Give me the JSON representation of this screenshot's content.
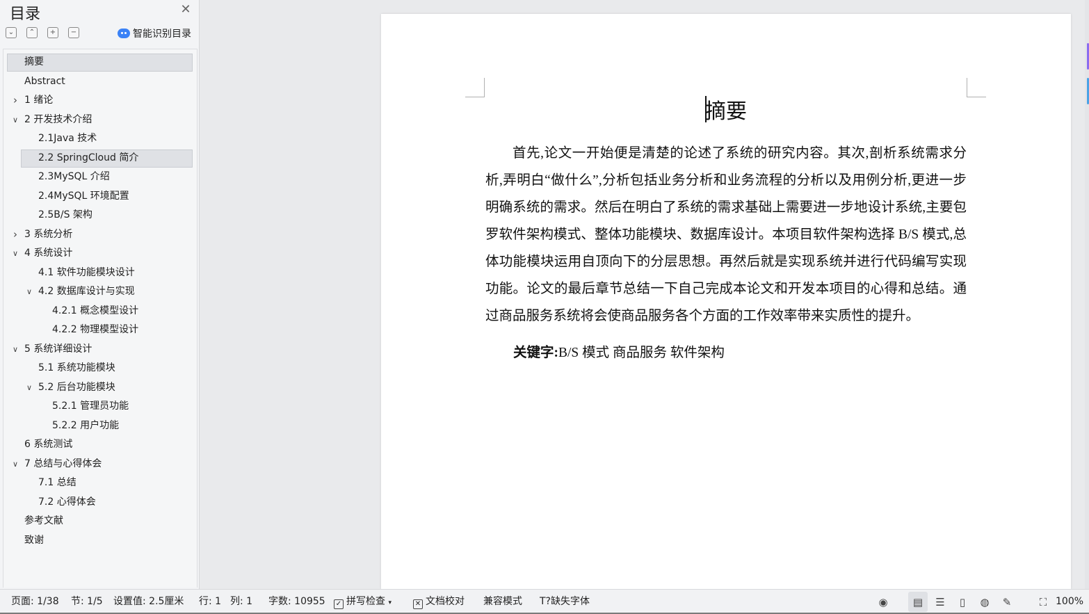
{
  "toc": {
    "title": "目录",
    "close_icon": "close-icon",
    "tools": [
      "collapse-all-icon",
      "expand-all-icon",
      "add-level-icon",
      "remove-level-icon"
    ],
    "smart_label": "智能识别目录",
    "items": [
      {
        "label": "摘要",
        "level": 1,
        "expander": "none",
        "selected": true
      },
      {
        "label": "Abstract",
        "level": 1,
        "expander": "none"
      },
      {
        "label": "1 绪论",
        "level": 1,
        "expander": "collapsed"
      },
      {
        "label": "2 开发技术介绍",
        "level": 1,
        "expander": "expanded"
      },
      {
        "label": "2.1Java 技术",
        "level": 2,
        "expander": "none"
      },
      {
        "label": "2.2 SpringCloud 简介",
        "level": 2,
        "expander": "none",
        "selected": true
      },
      {
        "label": "2.3MySQL  介绍",
        "level": 2,
        "expander": "none"
      },
      {
        "label": "2.4MySQL 环境配置",
        "level": 2,
        "expander": "none"
      },
      {
        "label": "2.5B/S 架构",
        "level": 2,
        "expander": "none"
      },
      {
        "label": "3 系统分析",
        "level": 1,
        "expander": "collapsed"
      },
      {
        "label": "4 系统设计",
        "level": 1,
        "expander": "expanded"
      },
      {
        "label": "4.1  软件功能模块设计",
        "level": 2,
        "expander": "none"
      },
      {
        "label": "4.2 数据库设计与实现",
        "level": 2,
        "expander": "expanded"
      },
      {
        "label": "4.2.1 概念模型设计",
        "level": 3,
        "expander": "none"
      },
      {
        "label": "4.2.2 物理模型设计",
        "level": 3,
        "expander": "none"
      },
      {
        "label": "5 系统详细设计",
        "level": 1,
        "expander": "expanded"
      },
      {
        "label": "5.1 系统功能模块",
        "level": 2,
        "expander": "none"
      },
      {
        "label": "5.2 后台功能模块",
        "level": 2,
        "expander": "expanded"
      },
      {
        "label": "5.2.1 管理员功能",
        "level": 3,
        "expander": "none"
      },
      {
        "label": "5.2.2 用户功能",
        "level": 3,
        "expander": "none"
      },
      {
        "label": "6 系统测试",
        "level": 1,
        "expander": "none"
      },
      {
        "label": "7 总结与心得体会",
        "level": 1,
        "expander": "expanded"
      },
      {
        "label": "7.1  总结",
        "level": 2,
        "expander": "none"
      },
      {
        "label": "7.2  心得体会",
        "level": 2,
        "expander": "none"
      },
      {
        "label": "参考文献",
        "level": 1,
        "expander": "none"
      },
      {
        "label": "致谢",
        "level": 1,
        "expander": "none"
      }
    ]
  },
  "document": {
    "title": "摘要",
    "body": "首先,论文一开始便是清楚的论述了系统的研究内容。其次,剖析系统需求分析,弄明白“做什么”,分析包括业务分析和业务流程的分析以及用例分析,更进一步明确系统的需求。然后在明白了系统的需求基础上需要进一步地设计系统,主要包罗软件架构模式、整体功能模块、数据库设计。本项目软件架构选择 B/S 模式,总体功能模块运用自顶向下的分层思想。再然后就是实现系统并进行代码编写实现功能。论文的最后章节总结一下自己完成本论文和开发本项目的心得和总结。通过商品服务系统将会使商品服务各个方面的工作效率带来实质性的提升。",
    "keywords_label": "关键字:",
    "keywords": "B/S 模式  商品服务  软件架构"
  },
  "status": {
    "page": "页面: 1/38",
    "section": "节: 1/5",
    "setting": "设置值: 2.5厘米",
    "row": "行: 1",
    "col": "列: 1",
    "word_count": "字数: 10955",
    "spell_check": "拼写检查",
    "doc_proof": "文档校对",
    "compat_mode": "兼容模式",
    "missing_fonts": "缺失字体",
    "zoom": "100%"
  },
  "colors": {
    "accent": "#3b82f6",
    "strip_purple": "#8b6cf0",
    "strip_blue": "#4aa3e6"
  }
}
